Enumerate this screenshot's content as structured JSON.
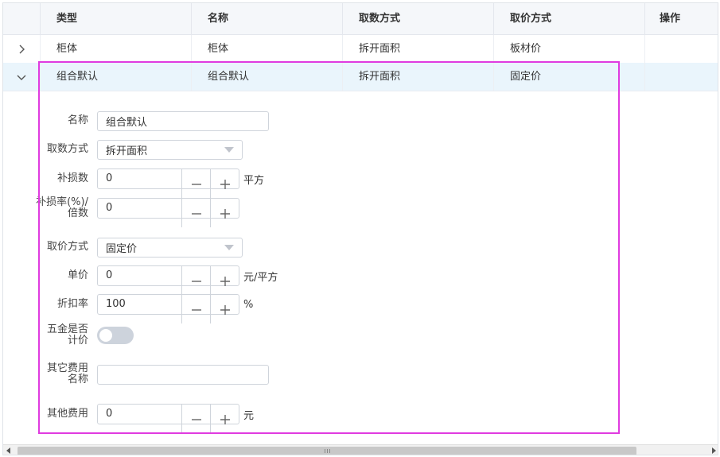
{
  "table": {
    "columns": [
      "类型",
      "名称",
      "取数方式",
      "取价方式",
      "操作"
    ],
    "rows": [
      {
        "type": "柜体",
        "name": "柜体",
        "qty_method": "拆开面积",
        "price_method": "板材价"
      },
      {
        "type": "组合默认",
        "name": "组合默认",
        "qty_method": "拆开面积",
        "price_method": "固定价"
      }
    ]
  },
  "form": {
    "name_label": "名称",
    "name_value": "组合默认",
    "qty_method_label": "取数方式",
    "qty_method_value": "拆开面积",
    "loss_label": "补损数",
    "loss_value": "0",
    "loss_unit": "平方",
    "loss_rate_label_1": "补损率(%)/",
    "loss_rate_label_2": "倍数",
    "loss_rate_value": "0",
    "price_method_label": "取价方式",
    "price_method_value": "固定价",
    "unit_price_label": "单价",
    "unit_price_value": "0",
    "unit_price_unit": "元/平方",
    "discount_label": "折扣率",
    "discount_value": "100",
    "discount_unit": "%",
    "hardware_label_1": "五金是否",
    "hardware_label_2": "计价",
    "hardware_priced": false,
    "other_fee_name_label_1": "其它费用",
    "other_fee_name_label_2": "名称",
    "other_fee_name_value": "",
    "other_fee_label": "其他费用",
    "other_fee_value": "0",
    "other_fee_unit": "元"
  },
  "colors": {
    "highlight": "#e03be0",
    "expanded_row_bg": "#eaf5fc",
    "header_bg": "#f5f7fa"
  },
  "icons": {
    "collapsed_row": "chevron-right-icon",
    "expanded_row": "chevron-down-icon",
    "minus": "minus-icon",
    "plus": "plus-icon",
    "dropdown": "dropdown-caret-icon"
  }
}
